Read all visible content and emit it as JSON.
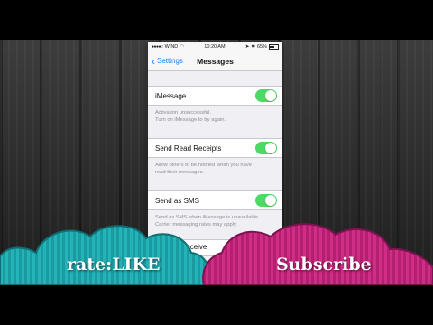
{
  "statusbar": {
    "carrier": "WIND",
    "time": "10:20 AM",
    "battery": "65%"
  },
  "navbar": {
    "back_label": "Settings",
    "title": "Messages"
  },
  "settings": [
    {
      "label": "iMessage",
      "on": true,
      "footer": "Activation unsuccessful.\nTurn on iMessage to try again."
    },
    {
      "label": "Send Read Receipts",
      "on": true,
      "footer": "Allow others to be notified when you have\nread their messages."
    },
    {
      "label": "Send as SMS",
      "on": true,
      "footer": "Send as SMS when iMessage is unavailable.\nCarrier messaging rates may apply."
    }
  ],
  "partial_row_label": "Send & Receive",
  "overlay": {
    "left_text": "rate:LIKE",
    "right_text": "Subscribe"
  },
  "colors": {
    "toggle_on": "#4cd964",
    "link": "#147efb",
    "cloud_left": "#1fa3a8",
    "cloud_right": "#c2257a"
  }
}
